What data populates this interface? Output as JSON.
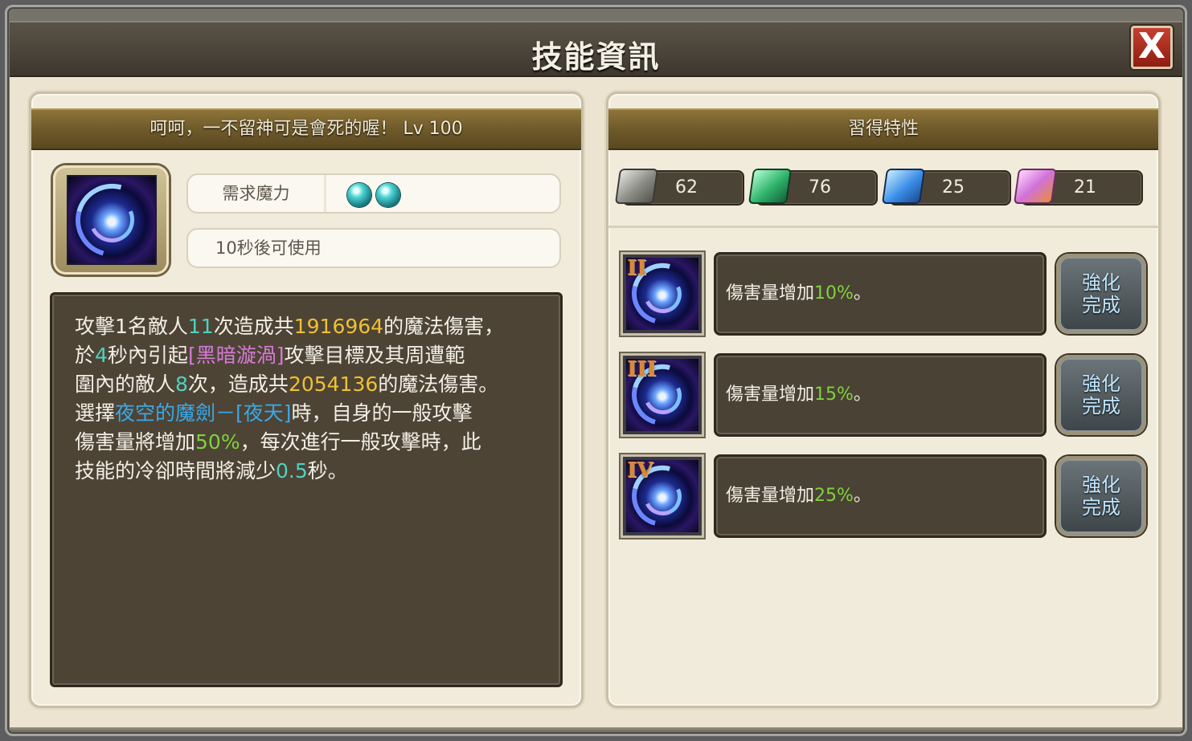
{
  "window": {
    "title": "技能資訊",
    "close_label": "X"
  },
  "skill": {
    "header": "呵呵，一不留神可是會死的喔！ Lv  100",
    "mana_label": "需求魔力",
    "cooldown_text": "10秒後可使用",
    "description": {
      "l1_a": "攻擊1名敵人",
      "l1_b": "11",
      "l1_c": "次造成共",
      "l1_d": "1916964",
      "l1_e": "的魔法傷害，",
      "l2_a": "於",
      "l2_b": "4",
      "l2_c": "秒內引起",
      "l2_d": "[黑暗漩渦]",
      "l2_e": "攻擊目標及其周遭範",
      "l3_a": "圍內的敵人",
      "l3_b": "8",
      "l3_c": "次，造成共",
      "l3_d": "2054136",
      "l3_e": "的魔法傷害。",
      "l4_a": "選擇",
      "l4_b": "夜空的魔劍－[夜天]",
      "l4_c": "時，自身的一般攻擊",
      "l5_a": "傷害量將增加",
      "l5_b": "50%",
      "l5_c": "，每次進行一般攻擊時，此",
      "l6_a": "技能的冷卻時間將減少",
      "l6_b": "0.5",
      "l6_c": "秒。"
    }
  },
  "traits": {
    "header": "習得特性",
    "stats": [
      {
        "icon": "grey-gem-icon",
        "value": "62"
      },
      {
        "icon": "green-gem-icon",
        "value": "76"
      },
      {
        "icon": "blue-gem-icon",
        "value": "25"
      },
      {
        "icon": "pink-gem-icon",
        "value": "21"
      }
    ],
    "rows": [
      {
        "level": "II",
        "text": "傷害量增加",
        "percent": "10%",
        "suffix": "。",
        "button": "強化\n完成"
      },
      {
        "level": "III",
        "text": "傷害量增加",
        "percent": "15%",
        "suffix": "。",
        "button": "強化\n完成"
      },
      {
        "level": "IV",
        "text": "傷害量增加",
        "percent": "25%",
        "suffix": "。",
        "button": "強化\n完成"
      }
    ]
  },
  "colors": {
    "highlight_green": "#4fd1c0",
    "highlight_gold": "#f0c132",
    "highlight_pink": "#d77ad8",
    "highlight_blue": "#3aa9e8",
    "highlight_lime": "#7fd33a"
  }
}
